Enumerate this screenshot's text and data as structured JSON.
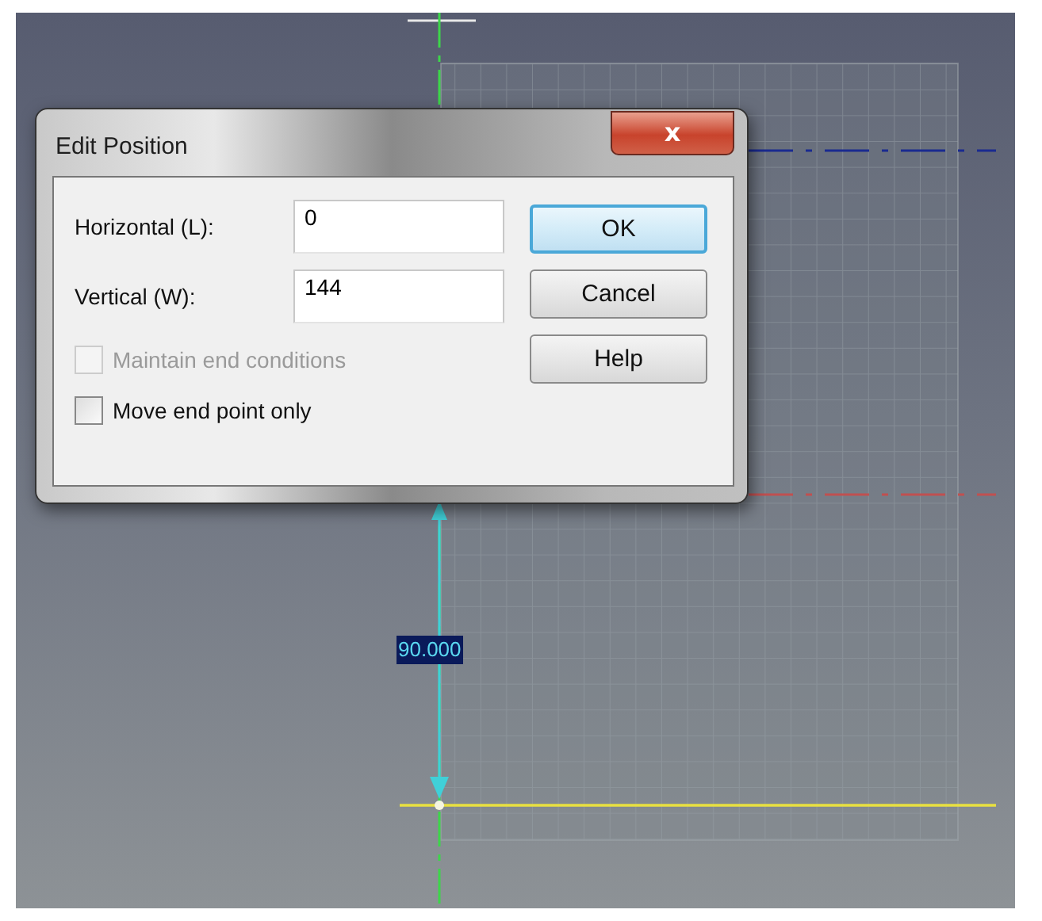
{
  "canvas": {
    "dimension_label": "90.000"
  },
  "dialog": {
    "title": "Edit Position",
    "close_label": "x",
    "fields": [
      {
        "label": "Horizontal (L):",
        "value": "0"
      },
      {
        "label": "Vertical (W):",
        "value": "144"
      }
    ],
    "buttons": [
      {
        "label": "OK",
        "default": true
      },
      {
        "label": "Cancel",
        "default": false
      },
      {
        "label": "Help",
        "default": false
      }
    ],
    "checkboxes": [
      {
        "label": "Maintain end conditions",
        "checked": false,
        "disabled": true
      },
      {
        "label": "Move end point only",
        "checked": false,
        "disabled": false
      }
    ]
  }
}
